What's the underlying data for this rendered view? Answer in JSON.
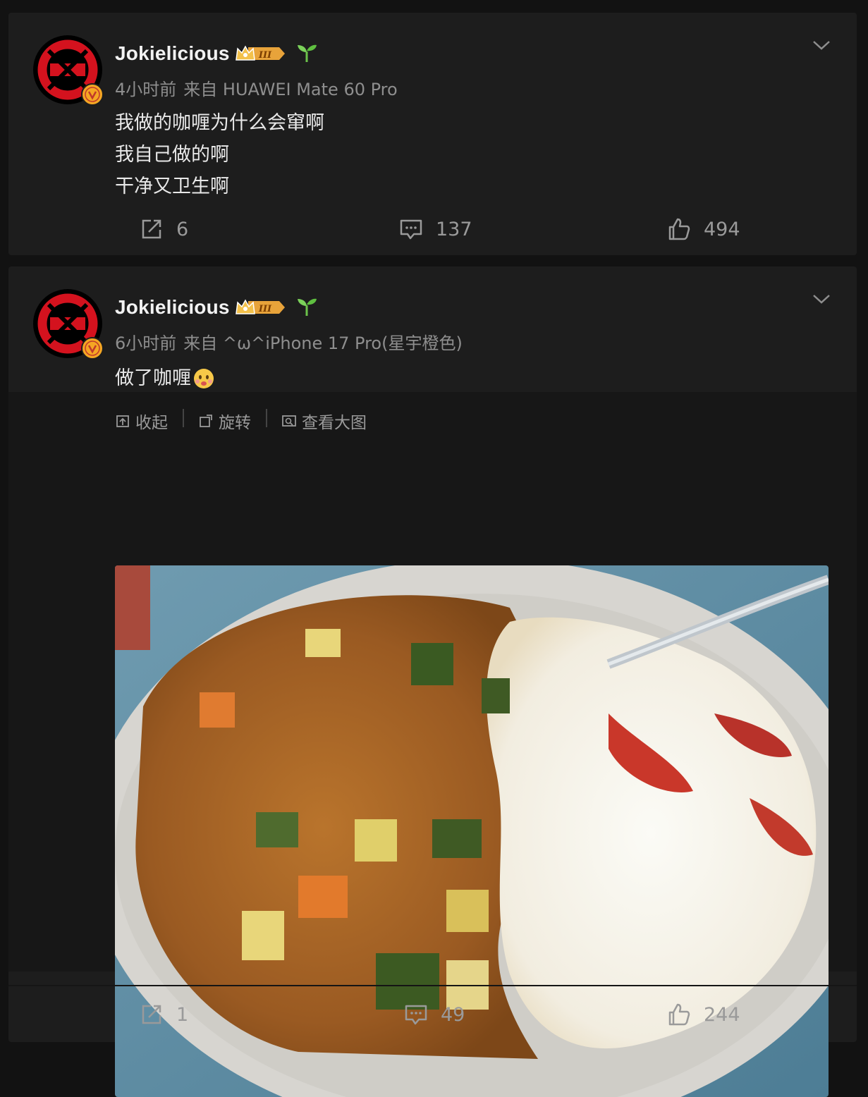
{
  "posts": [
    {
      "author": "Jokielicious",
      "time": "4小时前",
      "source": "来自 HUAWEI Mate 60 Pro",
      "lines": [
        "我做的咖喱为什么会窜啊",
        "我自己做的啊",
        "干净又卫生啊"
      ],
      "reposts": "6",
      "comments": "137",
      "likes": "494"
    },
    {
      "author": "Jokielicious",
      "time": "6小时前",
      "source": "来自 ^ω^iPhone 17 Pro(星宇橙色)",
      "text": "做了咖喱",
      "image_toolbar": {
        "collapse": "收起",
        "rotate": "旋转",
        "view_large": "查看大图"
      },
      "reposts": "1",
      "comments": "49",
      "likes": "244"
    }
  ],
  "badges": {
    "crown_level": "III"
  },
  "colors": {
    "background": "#121212",
    "card": "#1d1d1d",
    "muted": "#8e8e8e",
    "avatar_red": "#d4121e",
    "verified": "#f5a623"
  },
  "icons": [
    "repost-icon",
    "comment-icon",
    "like-icon",
    "chevron-down-icon",
    "verified-badge-icon",
    "crown-icon",
    "sprout-icon",
    "emoji-icon"
  ]
}
